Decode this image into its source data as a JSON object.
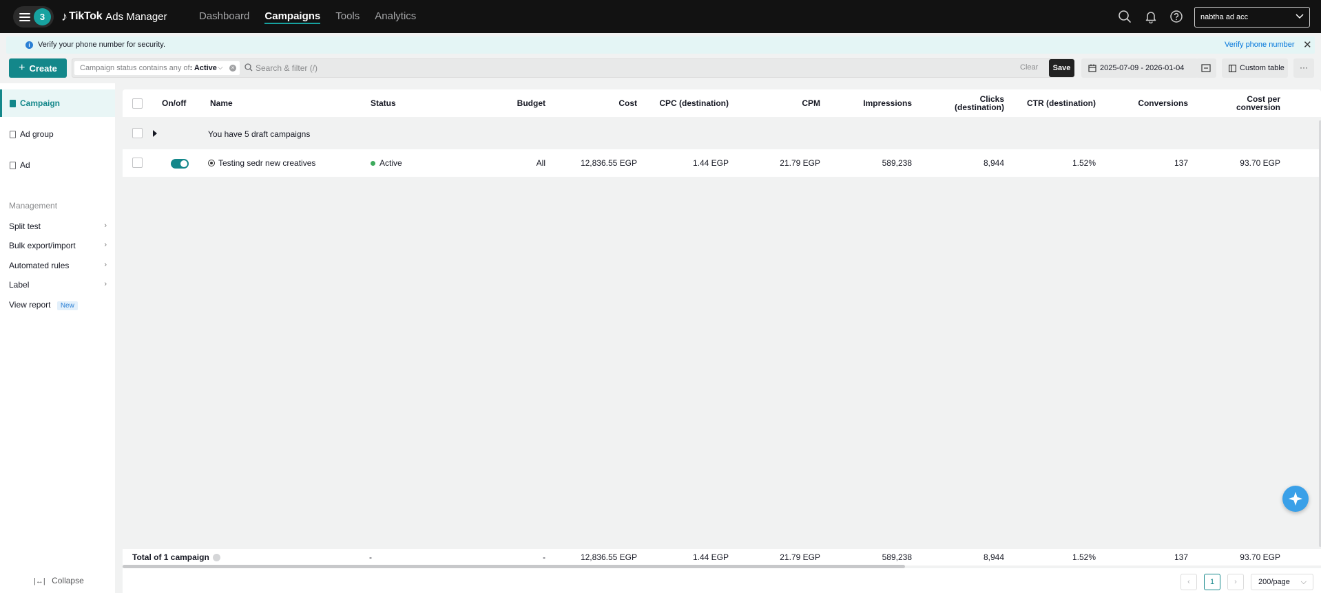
{
  "topbar": {
    "menu_badge": "3",
    "logo_brand": "TikTok",
    "logo_product": "Ads Manager",
    "nav": [
      "Dashboard",
      "Campaigns",
      "Tools",
      "Analytics"
    ],
    "active_nav": "Campaigns",
    "account": "nabtha ad acc",
    "icons": [
      "search-icon",
      "bell-icon",
      "help-icon"
    ]
  },
  "notice": {
    "message": "Verify your phone number for security.",
    "action": "Verify phone number"
  },
  "toolbar": {
    "create_label": "Create",
    "filter_key": "Campaign status contains any of",
    "filter_value": ": Active",
    "search_placeholder": "Search & filter (/)",
    "clear_label": "Clear",
    "save_label": "Save",
    "date_range": "2025-07-09 - 2026-01-04",
    "custom_table_label": "Custom table",
    "more_label": "···"
  },
  "sidebar": {
    "levels": [
      "Campaign",
      "Ad group",
      "Ad"
    ],
    "active_level": "Campaign",
    "management_title": "Management",
    "management_items": [
      "Split test",
      "Bulk export/import",
      "Automated rules",
      "Label",
      "View report"
    ],
    "new_badge": "New",
    "collapse_label": "Collapse"
  },
  "table": {
    "columns": {
      "onoff": "On/off",
      "name": "Name",
      "status": "Status",
      "budget": "Budget",
      "cost": "Cost",
      "cpc": "CPC (destination)",
      "cpm": "CPM",
      "impressions": "Impressions",
      "clicks": "Clicks (destination)",
      "ctr": "CTR (destination)",
      "conversions": "Conversions",
      "cost_per_conversion": "Cost per conversion"
    },
    "draft_text": "You have 5 draft campaigns",
    "rows": [
      {
        "on": true,
        "name": "Testing sedr new creatives",
        "status": "Active",
        "budget": "All",
        "cost": "12,836.55 EGP",
        "cpc": "1.44 EGP",
        "cpm": "21.79 EGP",
        "impressions": "589,238",
        "clicks": "8,944",
        "ctr": "1.52%",
        "conversions": "137",
        "cost_per_conversion": "93.70 EGP"
      }
    ],
    "total": {
      "label": "Total of 1 campaign",
      "status": "-",
      "budget": "-",
      "cost": "12,836.55 EGP",
      "cpc": "1.44 EGP",
      "cpm": "21.79 EGP",
      "impressions": "589,238",
      "clicks": "8,944",
      "ctr": "1.52%",
      "conversions": "137",
      "cost_per_conversion": "93.70 EGP"
    }
  },
  "pagination": {
    "current_page": "1",
    "per_page": "200/page"
  },
  "colors": {
    "accent": "#13878a",
    "topbar_bg": "#121212",
    "active_status": "#3daa5c"
  }
}
